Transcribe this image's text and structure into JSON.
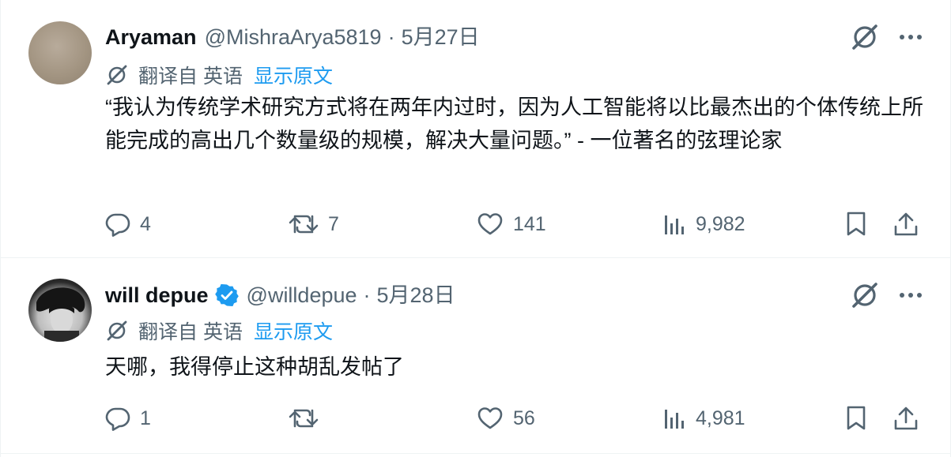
{
  "tweets": [
    {
      "display_name": "Aryaman",
      "handle": "@MishraArya5819",
      "separator": "·",
      "date": "5月27日",
      "translated_from": "翻译自 英语",
      "show_original": "显示原文",
      "text": "“我认为传统学术研究方式将在两年内过时，因为人工智能将以比最杰出的个体传统上所能完成的高出几个数量级的规模，解决大量问题。” - 一位著名的弦理论家",
      "replies": "4",
      "retweets": "7",
      "likes": "141",
      "views": "9,982",
      "verified": false
    },
    {
      "display_name": "will depue",
      "handle": "@willdepue",
      "separator": "·",
      "date": "5月28日",
      "translated_from": "翻译自 英语",
      "show_original": "显示原文",
      "text": "天哪，我得停止这种胡乱发帖了",
      "replies": "1",
      "retweets": "",
      "likes": "56",
      "views": "4,981",
      "verified": true
    }
  ],
  "colors": {
    "text_primary": "#0f1419",
    "text_secondary": "#536471",
    "link": "#1d9bf0",
    "verified": "#1d9bf0",
    "border": "#eff3f4"
  },
  "icons": [
    "grok-icon",
    "more-icon",
    "translate-icon",
    "reply-icon",
    "retweet-icon",
    "like-icon",
    "views-icon",
    "bookmark-icon",
    "share-icon",
    "verified-badge-icon"
  ]
}
